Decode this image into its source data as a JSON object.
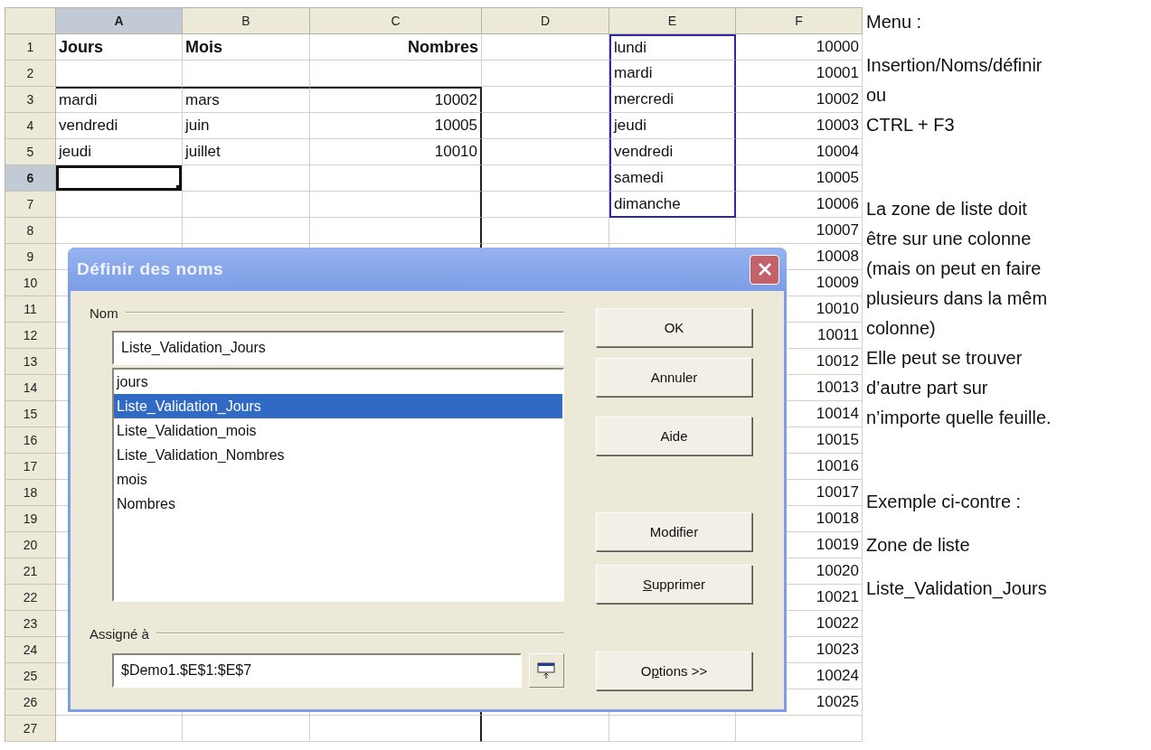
{
  "sheet": {
    "columns": [
      {
        "label": "A",
        "selected": true
      },
      {
        "label": "B",
        "selected": false
      },
      {
        "label": "C",
        "selected": false
      },
      {
        "label": "D",
        "selected": false
      },
      {
        "label": "E",
        "selected": false
      },
      {
        "label": "F",
        "selected": false
      }
    ],
    "rows": [
      {
        "label": "1",
        "selected": false,
        "bold": true,
        "in_range": true,
        "a": "Jours",
        "b": "Mois",
        "c": "Nombres",
        "e": "lundi",
        "f": "10000"
      },
      {
        "label": "2",
        "selected": false,
        "in_range": true,
        "e": "mardi",
        "f": "10001"
      },
      {
        "label": "3",
        "selected": false,
        "bold": false,
        "in_range": true,
        "a": "mardi",
        "b": "mars",
        "c": "10002",
        "e": "mercredi",
        "f": "10002"
      },
      {
        "label": "4",
        "selected": false,
        "bold": false,
        "in_range": true,
        "a": "vendredi",
        "b": "juin",
        "c": "10005",
        "e": "jeudi",
        "f": "10003"
      },
      {
        "label": "5",
        "selected": false,
        "bold": false,
        "in_range": true,
        "a": "jeudi",
        "b": "juillet",
        "c": "10010",
        "e": "vendredi",
        "f": "10004"
      },
      {
        "label": "6",
        "selected": true,
        "in_range": true,
        "e": "samedi",
        "f": "10005"
      },
      {
        "label": "7",
        "selected": false,
        "in_range": true,
        "e": "dimanche",
        "f": "10006"
      },
      {
        "label": "8",
        "selected": false,
        "in_range": false,
        "f": "10007"
      },
      {
        "label": "9",
        "selected": false,
        "f": "10008"
      },
      {
        "label": "10",
        "selected": false,
        "f": "10009"
      },
      {
        "label": "11",
        "selected": false,
        "f": "10010"
      },
      {
        "label": "12",
        "selected": false,
        "f": "10011"
      },
      {
        "label": "13",
        "selected": false,
        "f": "10012"
      },
      {
        "label": "14",
        "selected": false,
        "f": "10013"
      },
      {
        "label": "15",
        "selected": false,
        "f": "10014"
      },
      {
        "label": "16",
        "selected": false,
        "f": "10015"
      },
      {
        "label": "17",
        "selected": false,
        "f": "10016"
      },
      {
        "label": "18",
        "selected": false,
        "f": "10017"
      },
      {
        "label": "19",
        "selected": false,
        "f": "10018"
      },
      {
        "label": "20",
        "selected": false,
        "f": "10019"
      },
      {
        "label": "21",
        "selected": false,
        "f": "10020"
      },
      {
        "label": "22",
        "selected": false,
        "f": "10021"
      },
      {
        "label": "23",
        "selected": false,
        "f": "10022"
      },
      {
        "label": "24",
        "selected": false,
        "f": "10023"
      },
      {
        "label": "25",
        "selected": false,
        "f": "10024"
      },
      {
        "label": "26",
        "selected": false,
        "in_range": false,
        "f": "10025"
      },
      {
        "label": "27",
        "selected": false,
        "in_range": false
      }
    ]
  },
  "dialog": {
    "title": "Définir des noms",
    "name_group": {
      "label": "Nom",
      "value": "Liste_Validation_Jours",
      "items": [
        {
          "label": "jours",
          "selected": false
        },
        {
          "label": "Liste_Validation_Jours",
          "selected": true
        },
        {
          "label": "Liste_Validation_mois",
          "selected": false
        },
        {
          "label": "Liste_Validation_Nombres",
          "selected": false
        },
        {
          "label": "mois",
          "selected": false
        },
        {
          "label": "Nombres",
          "selected": false
        }
      ]
    },
    "assigned_group": {
      "label": "Assigné à",
      "value": "$Demo1.$E$1:$E$7"
    },
    "buttons": [
      {
        "label": "OK"
      },
      {
        "label": "Annuler"
      },
      {
        "label": "Aide"
      },
      {
        "label": "Modifier"
      },
      {
        "mnemonic": "S",
        "after": "upprimer"
      },
      {
        "before": "O",
        "mnemonic": "p",
        "after": "tions >>"
      }
    ]
  },
  "notes": [
    "Menu :",
    "Insertion/Noms/définir\nou\nCTRL + F3",
    "La zone de liste doit\nêtre sur une colonne\n(mais on peut en faire\nplusieurs dans la mêm\ncolonne)\nElle peut se trouver\nd’autre part sur\nn’importe quelle feuille.",
    "Exemple ci-contre :",
    "Zone de liste",
    "Liste_Validation_Jours"
  ]
}
